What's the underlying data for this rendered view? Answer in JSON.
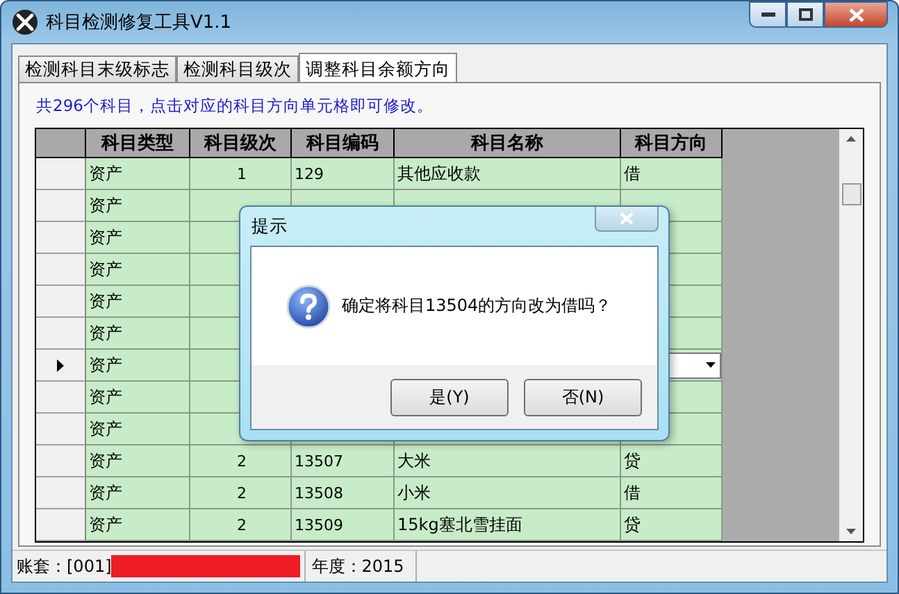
{
  "window": {
    "title": "科目检测修复工具V1.1"
  },
  "tabs": [
    {
      "label": "检测科目末级标志",
      "selected": false
    },
    {
      "label": "检测科目级次",
      "selected": false
    },
    {
      "label": "调整科目余额方向",
      "selected": true
    }
  ],
  "info": "共296个科目，点击对应的科目方向单元格即可修改。",
  "table": {
    "columns": [
      "科目类型",
      "科目级次",
      "科目编码",
      "科目名称",
      "科目方向"
    ],
    "rows": [
      {
        "type": "资产",
        "level": "1",
        "code": "129",
        "name": "其他应收款",
        "direction": "借",
        "current": false,
        "editing": false
      },
      {
        "type": "资产",
        "current": false,
        "editing": false
      },
      {
        "type": "资产",
        "current": false,
        "editing": false
      },
      {
        "type": "资产",
        "current": false,
        "editing": false
      },
      {
        "type": "资产",
        "current": false,
        "editing": false
      },
      {
        "type": "资产",
        "current": false,
        "editing": false
      },
      {
        "type": "资产",
        "current": true,
        "editing": true
      },
      {
        "type": "资产",
        "current": false,
        "editing": false
      },
      {
        "type": "资产",
        "current": false,
        "editing": false
      },
      {
        "type": "资产",
        "level": "2",
        "code": "13507",
        "name": "大米",
        "direction": "贷",
        "current": false,
        "editing": false
      },
      {
        "type": "资产",
        "level": "2",
        "code": "13508",
        "name": "小米",
        "direction": "借",
        "current": false,
        "editing": false
      },
      {
        "type": "资产",
        "level": "2",
        "code": "13509",
        "name": "15kg塞北雪挂面",
        "direction": "贷",
        "current": false,
        "editing": false
      }
    ]
  },
  "dialog": {
    "title": "提示",
    "message": "确定将科目13504的方向改为借吗？",
    "buttons": [
      "是(Y)",
      "否(N)"
    ]
  },
  "status_bar": {
    "account": "账套：[001]",
    "year": "年度：2015"
  }
}
